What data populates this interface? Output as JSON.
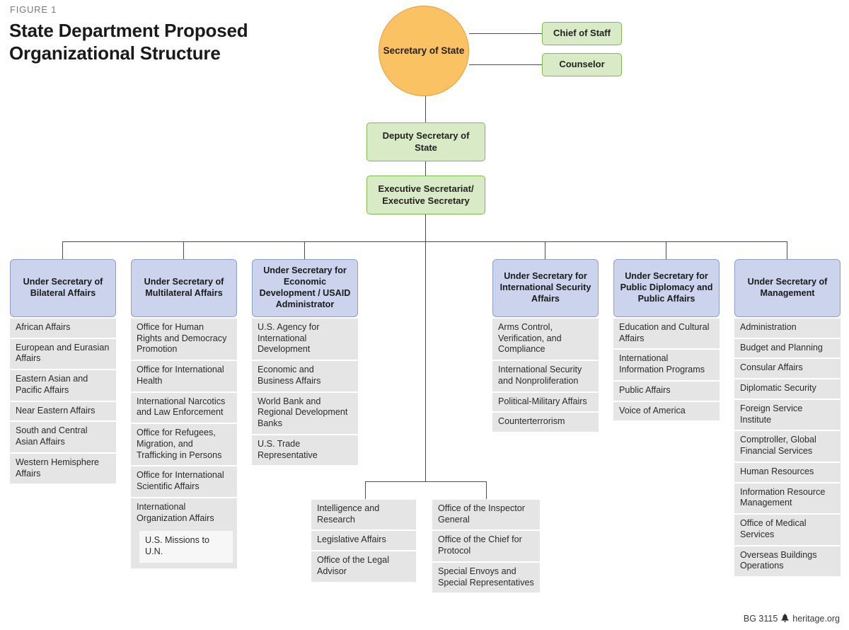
{
  "figure": {
    "label": "FIGURE 1",
    "title": "State Department Proposed Organizational Structure"
  },
  "colors": {
    "circle_fill": "#fbc263",
    "circle_border": "#e69b36",
    "green_fill": "#d8ebc6",
    "green_border": "#7fba4c",
    "header_fill": "#ccd3ec",
    "header_border": "#8e9ece",
    "item_fill": "#e5e5e5",
    "sub_item_fill": "#f7f7f7",
    "line": "#4d4d4d"
  },
  "top": {
    "secretary": "Secretary of State",
    "chief_of_staff": "Chief of Staff",
    "counselor": "Counselor",
    "deputy_secretary": "Deputy Secretary of State",
    "executive_secretariat": "Executive Secretariat/ Executive Secretary"
  },
  "columns": [
    {
      "header": "Under Secretary of Bilateral Affairs",
      "items": [
        "African Affairs",
        "European and Eurasian Affairs",
        "Eastern Asian and Pacific Affairs",
        "Near Eastern Affairs",
        "South and Central Asian Affairs",
        "Western Hemisphere Affairs"
      ]
    },
    {
      "header": "Under Secretary of Multilateral Affairs",
      "items": [
        "Office for Human Rights and Democracy Promotion",
        "Office for International Health",
        "International Narcotics and Law Enforcement",
        "Office for Refugees, Migration, and Trafficking in Persons",
        "Office for International Scientific Affairs",
        "International Organization Affairs"
      ],
      "sub_items": [
        "U.S. Missions to U.N."
      ]
    },
    {
      "header": "Under Secretary for Economic Development / USAID Administrator",
      "items": [
        "U.S. Agency for International Development",
        "Economic and Business Affairs",
        "World Bank and Regional Development Banks",
        "U.S. Trade Representative"
      ]
    },
    {
      "header": "Under Secretary for International Security Affairs",
      "items": [
        "Arms Control, Verification, and Compliance",
        "International Security and Nonproliferation",
        "Political-Military Affairs",
        "Counterterrorism"
      ]
    },
    {
      "header": "Under Secretary for Public Diplomacy and Public Affairs",
      "items": [
        "Education and Cultural Affairs",
        "International Information Programs",
        "Public Affairs",
        "Voice of America"
      ]
    },
    {
      "header": "Under Secretary of Management",
      "items": [
        "Administration",
        "Budget and Planning",
        "Consular Affairs",
        "Diplomatic Security",
        "Foreign Service Institute",
        "Comptroller, Global Financial Services",
        "Human Resources",
        "Information Resource Management",
        "Office of Medical Services",
        "Overseas Buildings Operations"
      ]
    }
  ],
  "bottom_groups": [
    {
      "items": [
        "Intelligence and Research",
        "Legislative Affairs",
        "Office of the Legal Advisor"
      ]
    },
    {
      "items": [
        "Office of the Inspector General",
        "Office of the Chief for Protocol",
        "Special Envoys and Special Representatives"
      ]
    }
  ],
  "footer": {
    "report_id": "BG 3115",
    "bell_icon": "bell-icon",
    "site": "heritage.org"
  }
}
